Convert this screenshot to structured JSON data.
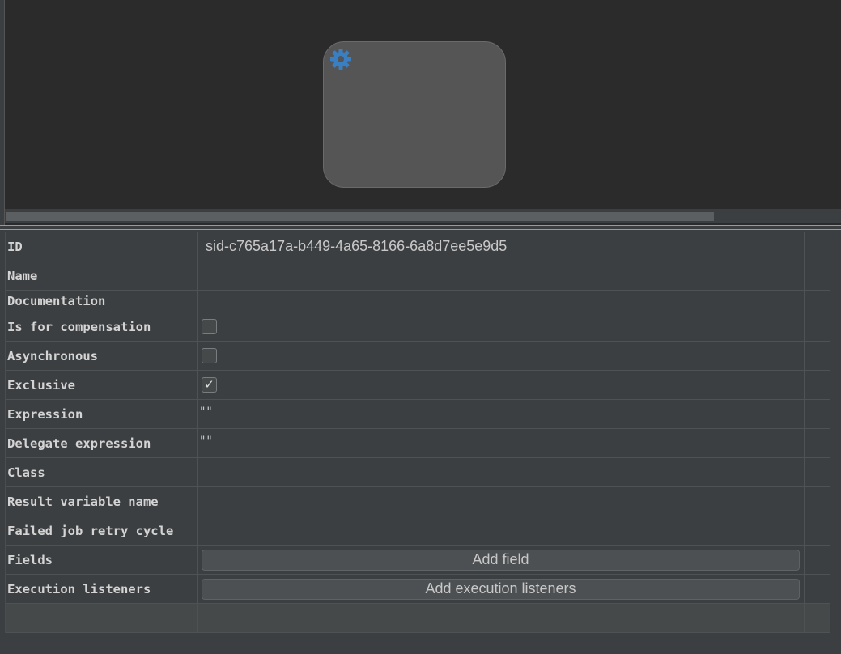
{
  "canvas": {
    "node_icon": "gear-icon",
    "accent_color": "#3a7fc1"
  },
  "properties": {
    "id_label": "ID",
    "id_value": "sid-c765a17a-b449-4a65-8166-6a8d7ee5e9d5",
    "name_label": "Name",
    "documentation_label": "Documentation",
    "compensation_label": "Is for compensation",
    "compensation_checked": false,
    "asynchronous_label": "Asynchronous",
    "asynchronous_checked": false,
    "exclusive_label": "Exclusive",
    "exclusive_checked": true,
    "checkmark": "✓",
    "expression_label": "Expression",
    "expression_value": "\"\"",
    "delegate_expression_label": "Delegate expression",
    "delegate_expression_value": "\"\"",
    "class_label": "Class",
    "result_variable_label": "Result variable name",
    "failed_job_retry_label": "Failed job retry cycle",
    "fields_label": "Fields",
    "fields_button": "Add field",
    "execution_listeners_label": "Execution listeners",
    "execution_listeners_button": "Add execution listeners"
  }
}
